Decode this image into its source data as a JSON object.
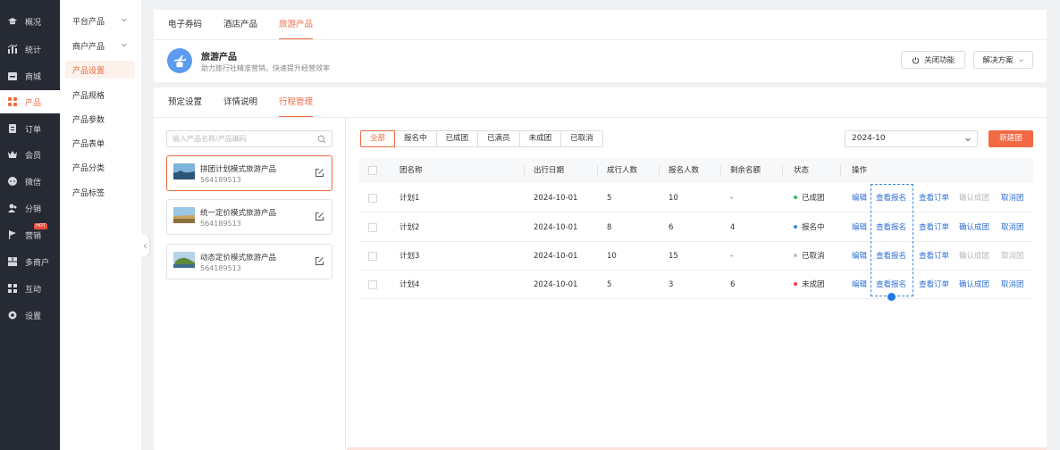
{
  "nav": {
    "items": [
      {
        "label": "概况",
        "icon": "graduation-cap-icon"
      },
      {
        "label": "统计",
        "icon": "bar-chart-icon"
      },
      {
        "label": "商城",
        "icon": "store-icon"
      },
      {
        "label": "产品",
        "icon": "grid-icon"
      },
      {
        "label": "订单",
        "icon": "order-icon"
      },
      {
        "label": "会员",
        "icon": "crown-icon"
      },
      {
        "label": "微信",
        "icon": "chat-icon"
      },
      {
        "label": "分销",
        "icon": "users-icon"
      },
      {
        "label": "营销",
        "icon": "flag-icon",
        "badge": "HOT"
      },
      {
        "label": "多商户",
        "icon": "shop-icon"
      },
      {
        "label": "互动",
        "icon": "apps-icon"
      },
      {
        "label": "设置",
        "icon": "gear-icon"
      }
    ],
    "active": "产品",
    "active_color": "#ef6a43"
  },
  "subnav": {
    "items": [
      {
        "label": "平台产品",
        "expandable": true
      },
      {
        "label": "商户产品",
        "expandable": true
      },
      {
        "label": "产品设置"
      },
      {
        "label": "产品规格"
      },
      {
        "label": "产品参数"
      },
      {
        "label": "产品表单"
      },
      {
        "label": "产品分类"
      },
      {
        "label": "产品标签"
      }
    ],
    "active": "产品设置"
  },
  "top_tabs": [
    "电子券码",
    "酒店产品",
    "旅游产品"
  ],
  "top_tab_active": "旅游产品",
  "product_header": {
    "title": "旅游产品",
    "desc": "助力旅行社精准营销，快速提升经营效率",
    "close_feature": "关闭功能",
    "solution": "解决方案"
  },
  "main_tabs": [
    "预定设置",
    "详情说明",
    "行程管理"
  ],
  "main_tab_active": "行程管理",
  "search": {
    "placeholder": "输入产品名称/产品编码"
  },
  "products": [
    {
      "name": "拼团计划模式旅游产品",
      "id": "564189513",
      "active": true
    },
    {
      "name": "统一定价模式旅游产品",
      "id": "564189513",
      "active": false
    },
    {
      "name": "动态定价模式旅游产品",
      "id": "564189513",
      "active": false
    }
  ],
  "filters": [
    "全部",
    "报名中",
    "已成团",
    "已满员",
    "未成团",
    "已取消"
  ],
  "filter_active": "全部",
  "month": "2024-10",
  "new_group": "新建团",
  "table": {
    "headers": [
      "团名称",
      "出行日期",
      "成行人数",
      "报名人数",
      "剩余名额",
      "状态",
      "操作"
    ],
    "rows": [
      {
        "name": "计划1",
        "date": "2024-10-01",
        "min": "5",
        "signed": "10",
        "left": "-",
        "status": "已成团",
        "status_color": "#3dba5a",
        "ops": [
          {
            "label": "编辑",
            "enabled": true
          },
          {
            "label": "查看报名",
            "enabled": true
          },
          {
            "label": "查看订单",
            "enabled": true
          },
          {
            "label": "确认成团",
            "enabled": false
          },
          {
            "label": "取消团",
            "enabled": true
          }
        ]
      },
      {
        "name": "计划2",
        "date": "2024-10-01",
        "min": "8",
        "signed": "6",
        "left": "4",
        "status": "报名中",
        "status_color": "#3a8ae0",
        "ops": [
          {
            "label": "编辑",
            "enabled": true
          },
          {
            "label": "查看报名",
            "enabled": true
          },
          {
            "label": "查看订单",
            "enabled": true
          },
          {
            "label": "确认成团",
            "enabled": true
          },
          {
            "label": "取消团",
            "enabled": true
          }
        ]
      },
      {
        "name": "计划3",
        "date": "2024-10-01",
        "min": "10",
        "signed": "15",
        "left": "-",
        "status": "已取消",
        "status_color": "#c0c0c0",
        "ops": [
          {
            "label": "编辑",
            "enabled": true
          },
          {
            "label": "查看报名",
            "enabled": true
          },
          {
            "label": "查看订单",
            "enabled": true
          },
          {
            "label": "确认成团",
            "enabled": false
          },
          {
            "label": "取消团",
            "enabled": false
          }
        ]
      },
      {
        "name": "计划4",
        "date": "2024-10-01",
        "min": "5",
        "signed": "3",
        "left": "6",
        "status": "未成团",
        "status_color": "#e5423b",
        "ops": [
          {
            "label": "编辑",
            "enabled": true
          },
          {
            "label": "查看报名",
            "enabled": true
          },
          {
            "label": "查看订单",
            "enabled": true
          },
          {
            "label": "确认成团",
            "enabled": true
          },
          {
            "label": "取消团",
            "enabled": true
          }
        ]
      }
    ]
  }
}
